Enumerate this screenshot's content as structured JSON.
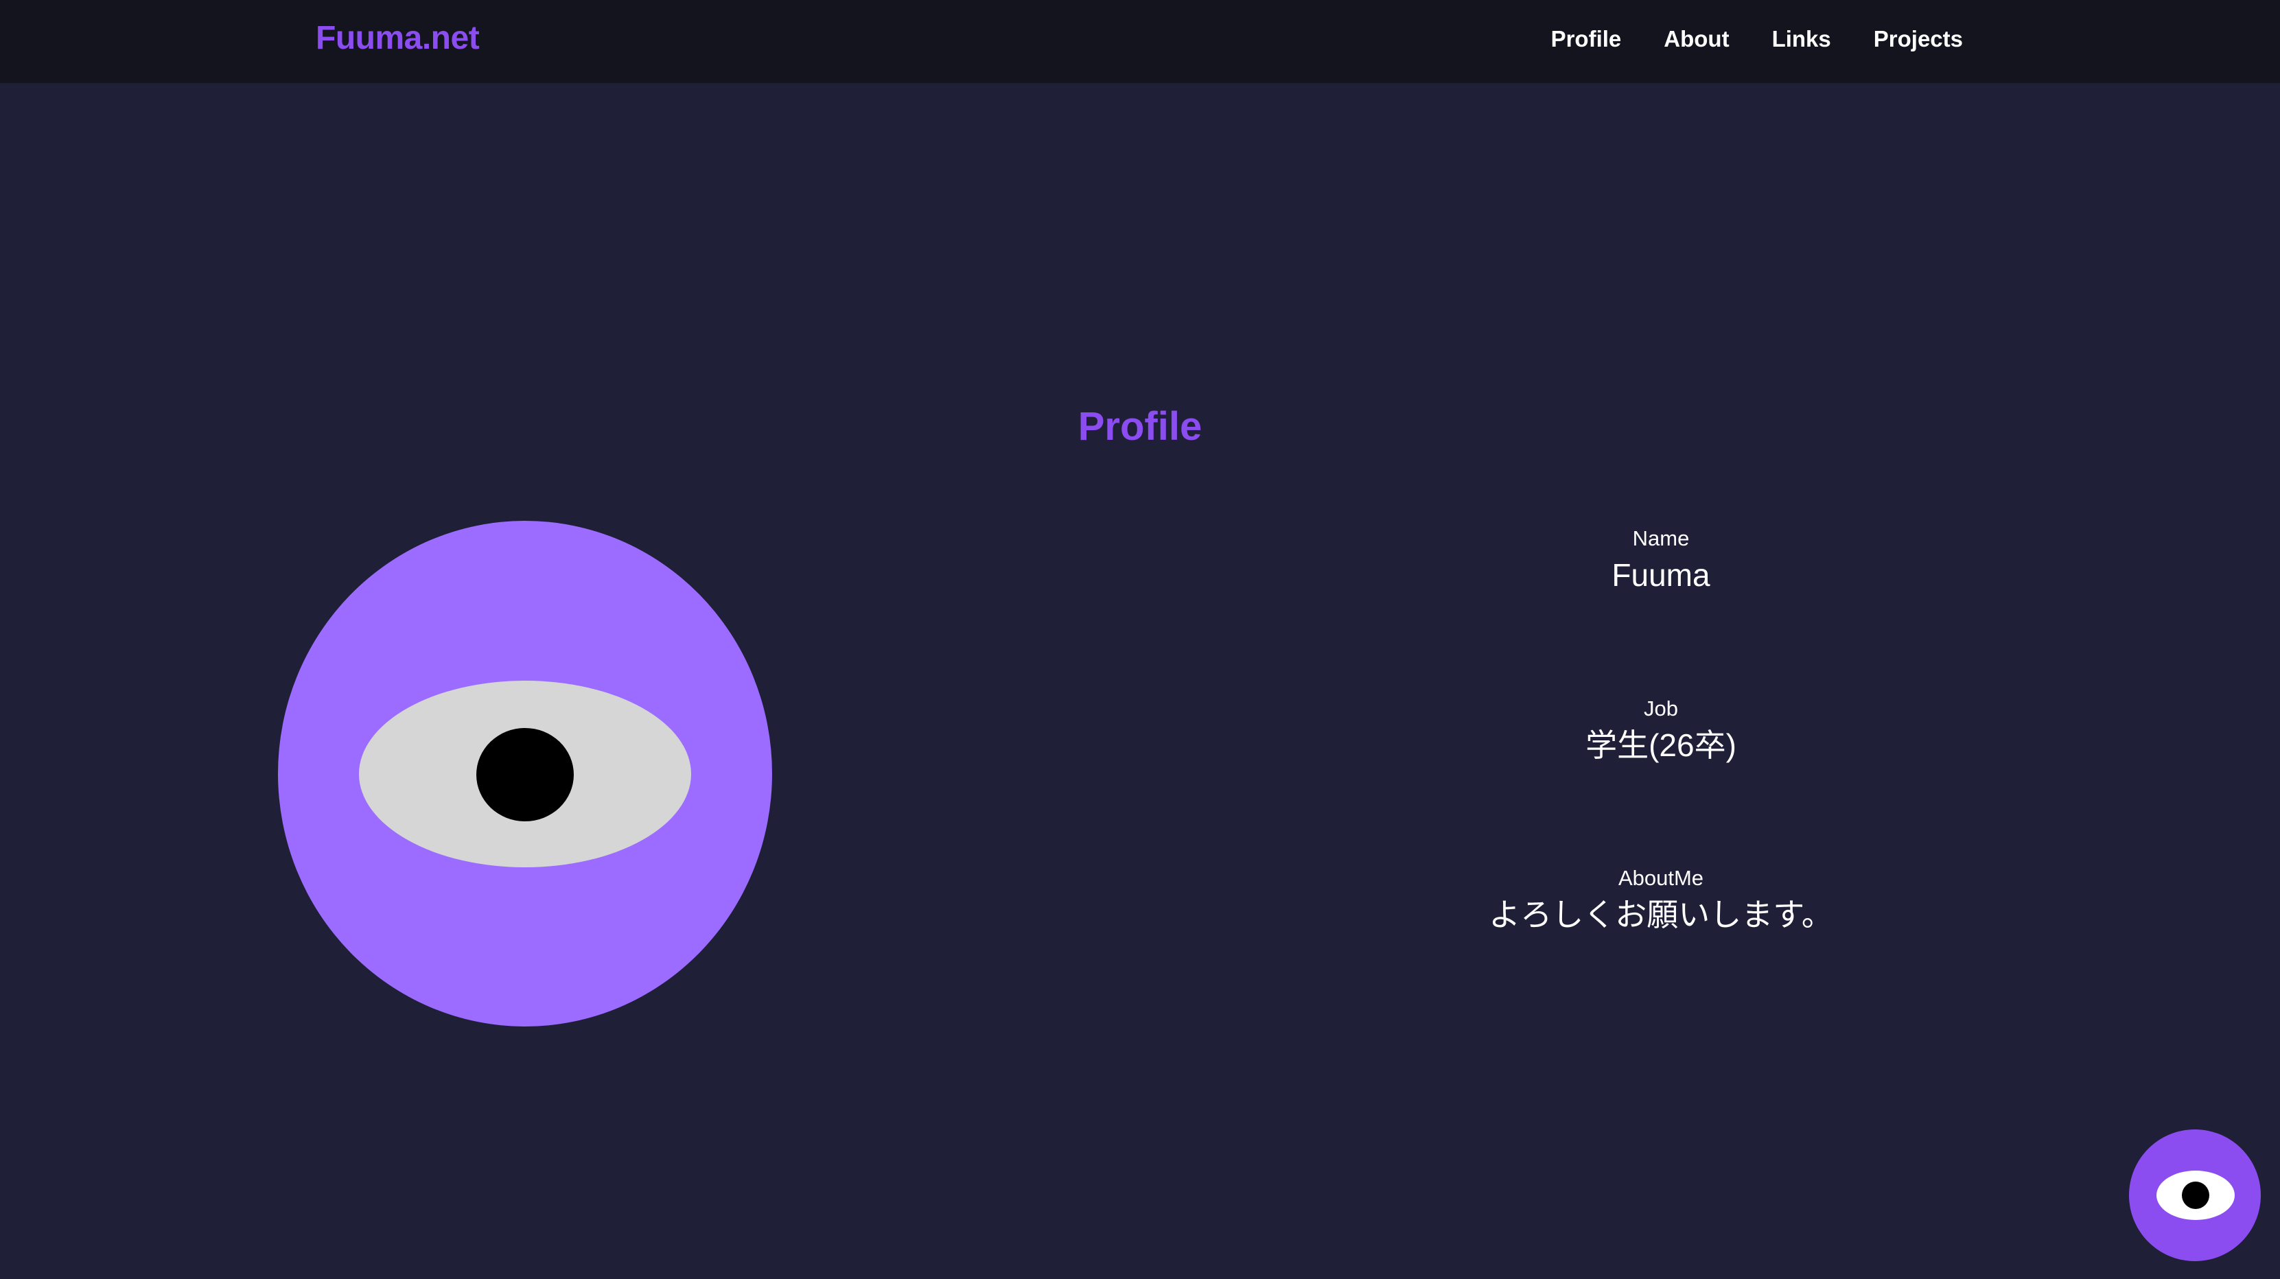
{
  "header": {
    "brand": "Fuuma.net",
    "nav": [
      {
        "label": "Profile"
      },
      {
        "label": "About"
      },
      {
        "label": "Links"
      },
      {
        "label": "Projects"
      }
    ]
  },
  "profile": {
    "title": "Profile",
    "fields": [
      {
        "label": "Name",
        "value": "Fuuma"
      },
      {
        "label": "Job",
        "value": "学生(26卒)"
      },
      {
        "label": "AboutMe",
        "value": "よろしくお願いします。"
      }
    ]
  },
  "icons": {
    "avatar": "eye-avatar",
    "floating_button": "eye-icon"
  },
  "colors": {
    "background": "#1f1f38",
    "header_bg": "#14141f",
    "accent": "#8b4df0",
    "avatar": "#9b6cff",
    "text": "#ffffff"
  }
}
